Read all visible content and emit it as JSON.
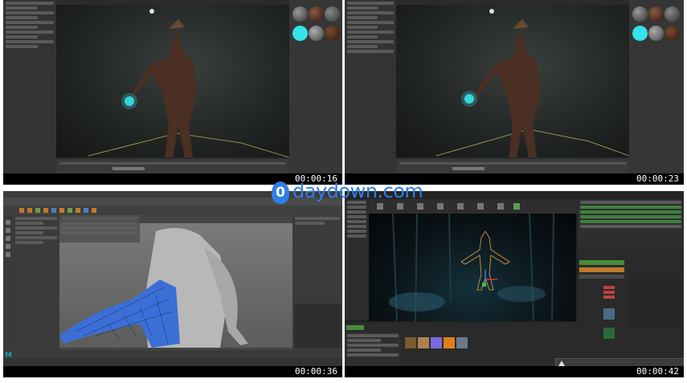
{
  "watermark": {
    "logo_glyph": "0",
    "text": "daydown.com",
    "color": "#2f7fe6"
  },
  "panels": [
    {
      "id": "q1",
      "timestamp": "00:00:16"
    },
    {
      "id": "q2",
      "timestamp": "00:00:23"
    },
    {
      "id": "q3",
      "timestamp": "00:00:36"
    },
    {
      "id": "q4",
      "timestamp": "00:00:42"
    }
  ],
  "maya": {
    "logo": "M"
  },
  "colors": {
    "accent_cyan": "#35e3ea",
    "viewport_bg": "#1b1e1d",
    "timestamp_bar": "#000000"
  }
}
